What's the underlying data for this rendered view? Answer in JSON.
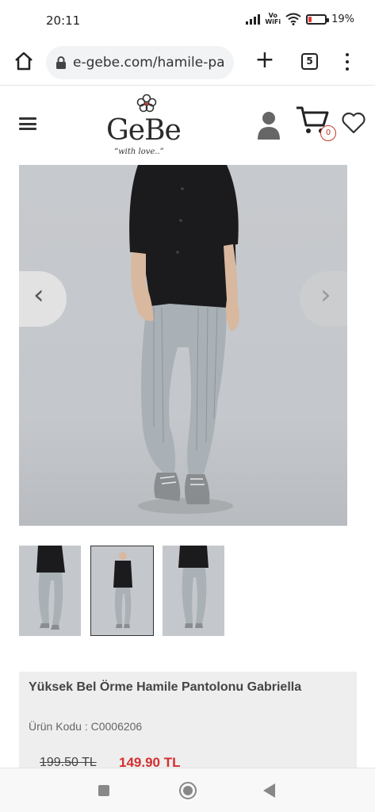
{
  "status_bar": {
    "time": "20:11",
    "network_label": "Vo\nWiFi",
    "battery_percent": "19%",
    "battery_level": 0.19
  },
  "browser": {
    "url": "e-gebe.com/hamile-pa",
    "tab_count": "5",
    "new_tab_symbol": "+"
  },
  "site_header": {
    "logo_text": "GeBe",
    "logo_tagline": "“with love..”",
    "cart_count": "0"
  },
  "gallery": {
    "prev_glyph": "‹",
    "next_glyph": "›",
    "thumbnails": [
      "thumb-1",
      "thumb-2",
      "thumb-3"
    ],
    "active_thumbnail": 2
  },
  "product": {
    "title": "Yüksek Bel Örme Hamile Pantolonu Gabriella",
    "code": "Ürün Kodu : C0006206",
    "old_price": "199.50 TL",
    "new_price": "149.90 TL"
  },
  "colors": {
    "accent_red": "#d32f2f",
    "top_black": "#1b1b1d",
    "pants_grey": "#a9b0b6"
  }
}
